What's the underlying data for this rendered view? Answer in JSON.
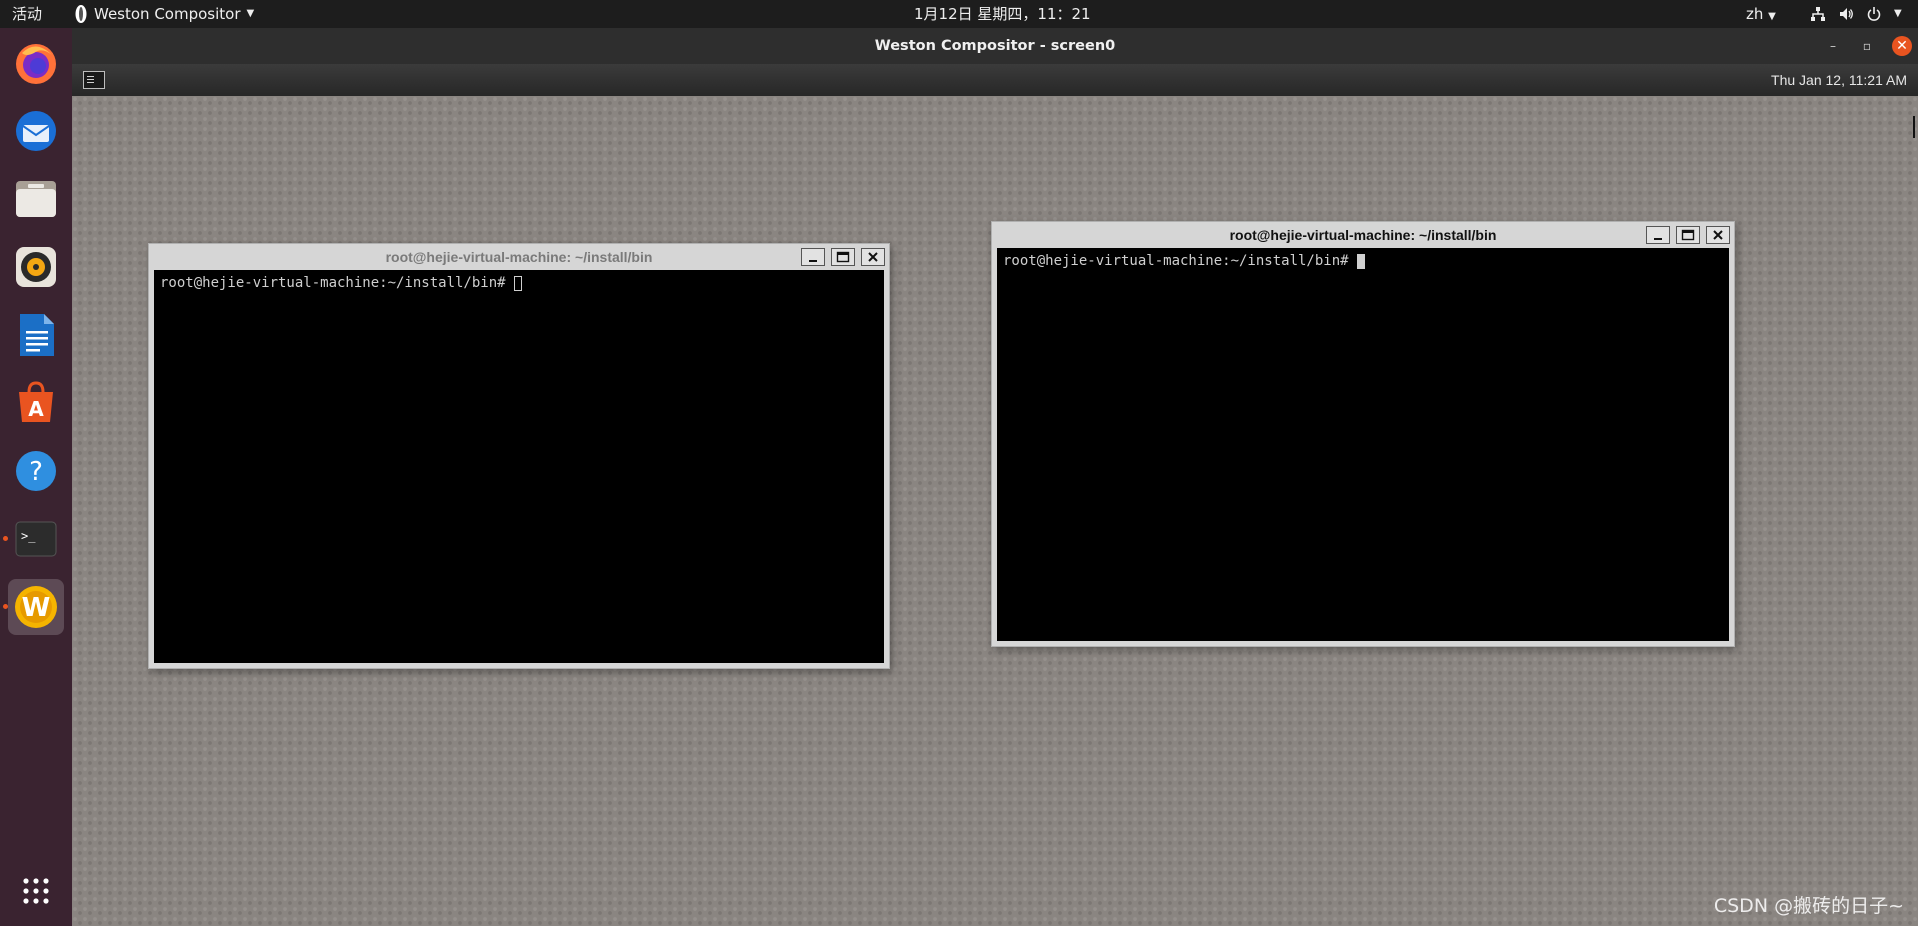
{
  "topbar": {
    "activities": "活动",
    "app_name": "Weston Compositor",
    "clock": "1月12日 星期四，11：21",
    "language": "zh"
  },
  "dock": {
    "items": [
      {
        "name": "firefox",
        "icon": "firefox-icon"
      },
      {
        "name": "thunderbird",
        "icon": "thunderbird-icon"
      },
      {
        "name": "files",
        "icon": "files-icon"
      },
      {
        "name": "rhythmbox",
        "icon": "rhythmbox-icon"
      },
      {
        "name": "libreoffice-writer",
        "icon": "writer-icon"
      },
      {
        "name": "ubuntu-software",
        "icon": "software-icon"
      },
      {
        "name": "help",
        "icon": "help-icon"
      },
      {
        "name": "terminal",
        "icon": "terminal-icon",
        "running": true
      },
      {
        "name": "weston",
        "icon": "weston-icon",
        "running": true,
        "active": true
      }
    ],
    "show_apps": "app-grid-icon"
  },
  "weston_window": {
    "title": "Weston Compositor - screen0",
    "panel_clock": "Thu Jan 12, 11:21 AM"
  },
  "terminals": [
    {
      "title": "root@hejie-virtual-machine: ~/install/bin",
      "prompt": "root@hejie-virtual-machine:~/install/bin#",
      "focused": false
    },
    {
      "title": "root@hejie-virtual-machine: ~/install/bin",
      "prompt": "root@hejie-virtual-machine:~/install/bin#",
      "focused": true
    }
  ],
  "watermark": "CSDN @搬砖的日子~",
  "colors": {
    "accent": "#e95420",
    "dock_bg": "#3a2330",
    "topbar_bg": "#1d1d1d",
    "desktop": "#8a8581"
  }
}
